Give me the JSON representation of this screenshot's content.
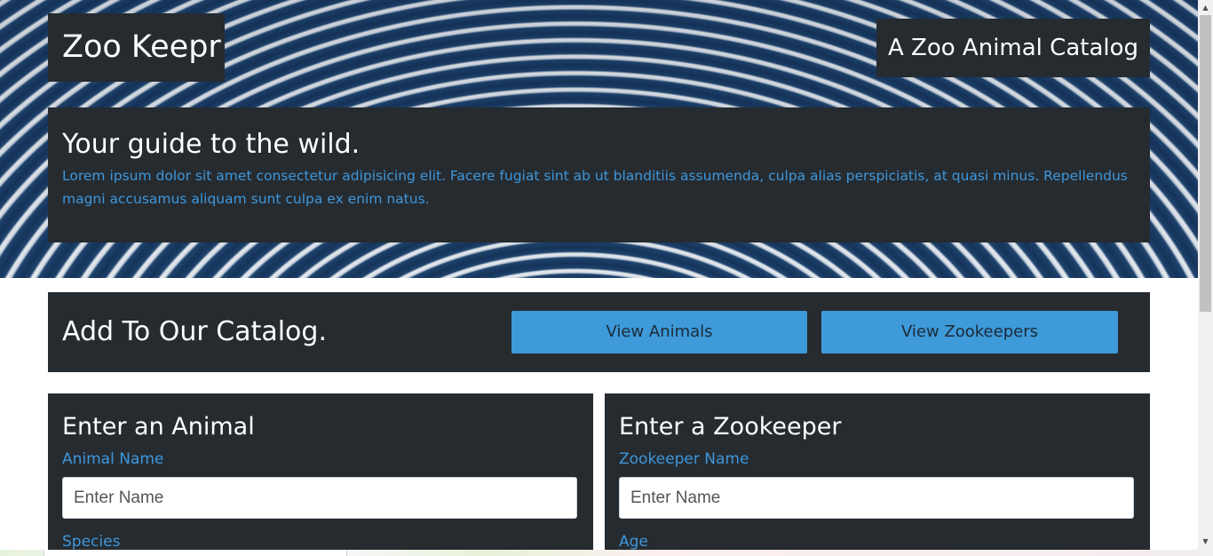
{
  "header": {
    "brand": "Zoo Keepr",
    "tagline": "A Zoo Animal Catalog"
  },
  "jumbotron": {
    "title": "Your guide to the wild.",
    "text": "Lorem ipsum dolor sit amet consectetur adipisicing elit. Facere fugiat sint ab ut blanditiis assumenda, culpa alias perspiciatis, at quasi minus. Repellendus magni accusamus aliquam sunt culpa ex enim natus."
  },
  "catalog": {
    "title": "Add To Our Catalog.",
    "view_animals_label": "View Animals",
    "view_zookeepers_label": "View Zookeepers"
  },
  "animal_form": {
    "title": "Enter an Animal",
    "name_label": "Animal Name",
    "name_placeholder": "Enter Name",
    "name_value": "",
    "next_label": "Species"
  },
  "zookeeper_form": {
    "title": "Enter a Zookeeper",
    "name_label": "Zookeeper Name",
    "name_placeholder": "Enter Name",
    "name_value": "",
    "next_label": "Age"
  },
  "scrollbar": {
    "up_icon": "chevron-up-icon",
    "down_icon": "chevron-down-icon"
  },
  "colors": {
    "panel": "#262b30",
    "accent": "#3e9ad9",
    "label": "#3e97db"
  }
}
